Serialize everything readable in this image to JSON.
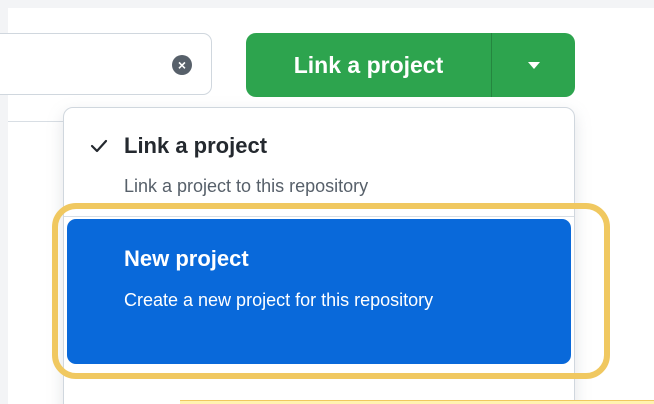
{
  "search": {
    "value": "",
    "placeholder": ""
  },
  "primary_button": {
    "label": "Link a project"
  },
  "menu": {
    "items": [
      {
        "title": "Link a project",
        "description": "Link a project to this repository",
        "checked": true
      },
      {
        "title": "New project",
        "description": "Create a new project for this repository",
        "highlighted": true
      }
    ]
  },
  "icons": {
    "clear": "clear-icon",
    "dropdown": "caret-down-icon",
    "checkmark": "check-icon"
  },
  "colors": {
    "button_green": "#2da44e",
    "menu_highlight_blue": "#0969da",
    "annotation_yellow": "#f0c860"
  }
}
